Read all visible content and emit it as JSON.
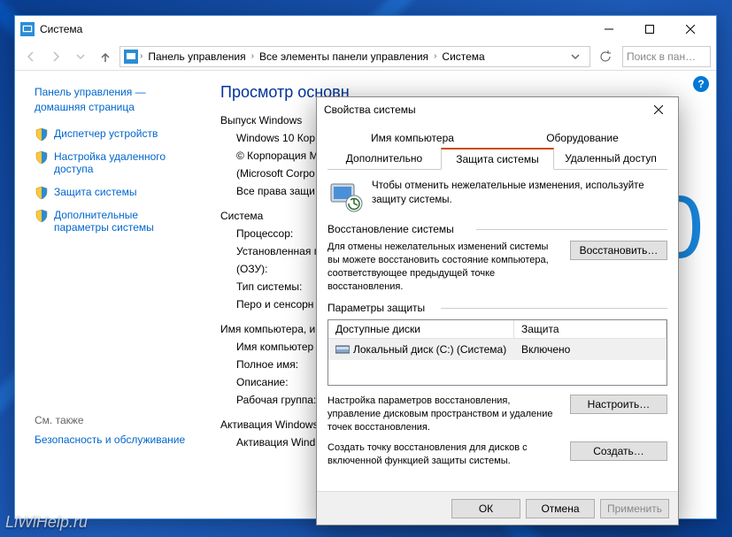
{
  "window": {
    "title": "Система",
    "breadcrumbs": [
      "Панель управления",
      "Все элементы панели управления",
      "Система"
    ],
    "search_placeholder": "Поиск в пан…"
  },
  "sidebar": {
    "home": "Панель управления — домашняя страница",
    "items": [
      "Диспетчер устройств",
      "Настройка удаленного доступа",
      "Защита системы",
      "Дополнительные параметры системы"
    ],
    "seealso_label": "См. также",
    "seealso": [
      "Безопасность и обслуживание"
    ]
  },
  "main": {
    "heading": "Просмотр основн",
    "edition_label": "Выпуск Windows",
    "edition_value": "Windows 10 Кор",
    "copyright1": "© Корпорация M",
    "copyright2": "(Microsoft Corpo",
    "copyright3": "Все права защи",
    "system_label": "Система",
    "cpu": "Процессор:",
    "ram1": "Установленная п",
    "ram2": "(ОЗУ):",
    "type": "Тип системы:",
    "pen": "Перо и сенсорн",
    "name_label": "Имя компьютера, и",
    "name": "Имя компьютер",
    "fullname": "Полное имя:",
    "desc": "Описание:",
    "workgroup": "Рабочая группа:",
    "activation_label": "Активация Windows",
    "activation": "Активация Wind"
  },
  "dialog": {
    "title": "Свойства системы",
    "tabs": {
      "row1": [
        "Имя компьютера",
        "Оборудование"
      ],
      "row2": [
        "Дополнительно",
        "Защита системы",
        "Удаленный доступ"
      ]
    },
    "head_text": "Чтобы отменить нежелательные изменения, используйте защиту системы.",
    "restore": {
      "label": "Восстановление системы",
      "text": "Для отмены нежелательных изменений системы вы можете восстановить состояние компьютера, соответствующее предыдущей точке восстановления.",
      "button": "Восстановить…"
    },
    "protection": {
      "label": "Параметры защиты",
      "col1": "Доступные диски",
      "col2": "Защита",
      "disk_name": "Локальный диск (C:) (Система)",
      "disk_status": "Включено",
      "config_text": "Настройка параметров восстановления, управление дисковым пространством и удаление точек восстановления.",
      "config_button": "Настроить…",
      "create_text": "Создать точку восстановления для дисков с включенной функцией защиты системы.",
      "create_button": "Создать…"
    },
    "buttons": {
      "ok": "ОК",
      "cancel": "Отмена",
      "apply": "Применить"
    }
  },
  "watermark": "LiWiHelp.ru"
}
